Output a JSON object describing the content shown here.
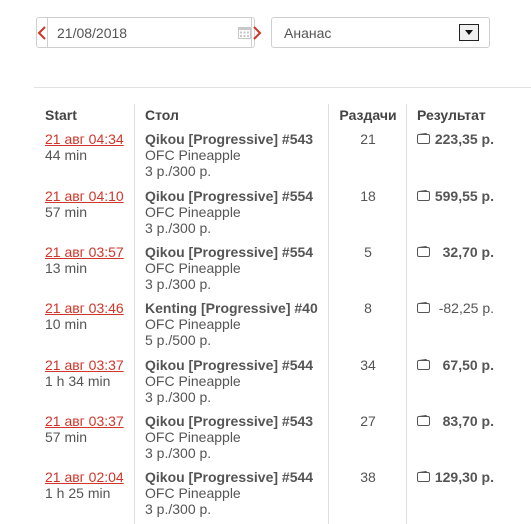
{
  "date_picker": {
    "value": "21/08/2018"
  },
  "select": {
    "value": "Ананас"
  },
  "headers": {
    "start": "Start",
    "table": "Стол",
    "hands": "Раздачи",
    "result": "Результат"
  },
  "rows": [
    {
      "start": "21 авг 04:34",
      "duration": "44 min",
      "table": "Qikou [Progressive] #543",
      "room": "OFC Pineapple",
      "stakes": "3 р./300 р.",
      "hands": "21",
      "result": "223,35 р.",
      "positive": true
    },
    {
      "start": "21 авг 04:10",
      "duration": "57 min",
      "table": "Qikou [Progressive] #554",
      "room": "OFC Pineapple",
      "stakes": "3 р./300 р.",
      "hands": "18",
      "result": "599,55 р.",
      "positive": true
    },
    {
      "start": "21 авг 03:57",
      "duration": "13 min",
      "table": "Qikou [Progressive] #554",
      "room": "OFC Pineapple",
      "stakes": "3 р./300 р.",
      "hands": "5",
      "result": "32,70 р.",
      "positive": true
    },
    {
      "start": "21 авг 03:46",
      "duration": "10 min",
      "table": "Kenting [Progressive] #40",
      "room": "OFC Pineapple",
      "stakes": "5 р./500 р.",
      "hands": "8",
      "result": "-82,25 р.",
      "positive": false
    },
    {
      "start": "21 авг 03:37",
      "duration": "1 h 34 min",
      "table": "Qikou [Progressive] #544",
      "room": "OFC Pineapple",
      "stakes": "3 р./300 р.",
      "hands": "34",
      "result": "67,50 р.",
      "positive": true
    },
    {
      "start": "21 авг 03:37",
      "duration": "57 min",
      "table": "Qikou [Progressive] #543",
      "room": "OFC Pineapple",
      "stakes": "3 р./300 р.",
      "hands": "27",
      "result": "83,70 р.",
      "positive": true
    },
    {
      "start": "21 авг 02:04",
      "duration": "1 h 25 min",
      "table": "Qikou [Progressive] #544",
      "room": "OFC Pineapple",
      "stakes": "3 р./300 р.",
      "hands": "38",
      "result": "129,30 р.",
      "positive": true
    }
  ],
  "colors": {
    "link": "#d0352a",
    "arrow": "#d0352a",
    "border": "#cfcfcf"
  },
  "icons": {
    "prev": "chevron-left-icon",
    "next": "chevron-right-icon",
    "calendar": "calendar-icon",
    "dropdown": "chevron-down-icon",
    "wallet": "wallet-icon"
  }
}
